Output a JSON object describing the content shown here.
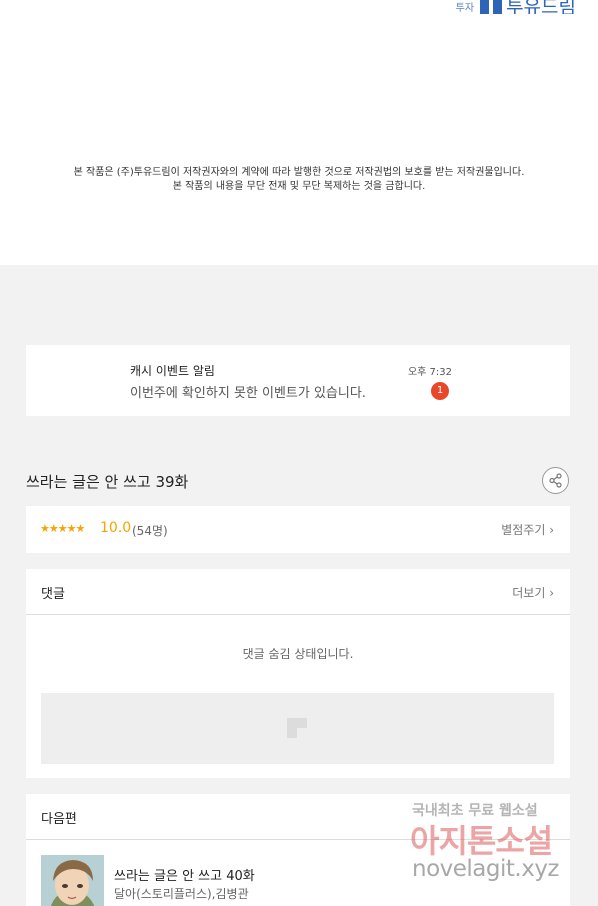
{
  "publisher": {
    "small_label": "투자",
    "brand": "투유드림"
  },
  "copyright": {
    "line1": "본 작품은 (주)투유드림이 저작권자와의 계약에 따라 발행한 것으로 저작권법의 보호를 받는 저작권물입니다.",
    "line2": "본 작품의 내용을 무단 전재 및 무단 복제하는 것을 금합니다."
  },
  "notification": {
    "title": "캐시 이벤트 알림",
    "message": "이번주에 확인하지 못한 이벤트가 있습니다.",
    "time": "오후 7:32",
    "badge": "1"
  },
  "episode": {
    "title": "쓰라는 글은 안 쓰고 39화",
    "share_icon": "share-icon"
  },
  "rating": {
    "stars": "★★★★★",
    "score": "10.0",
    "count": "(54명)",
    "rate_link": "별점주기"
  },
  "comments": {
    "label": "댓글",
    "more": "더보기",
    "hidden_message": "댓글 숨김 상태입니다."
  },
  "next": {
    "label": "다음편",
    "episode_title": "쓰라는 글은 안 쓰고 40화",
    "author": "달아(스토리플러스),김병관"
  },
  "watermark": {
    "line1": "국내최초 무료 웹소설",
    "line2": "아지톤소설",
    "line3": "novelagit.xyz"
  },
  "colors": {
    "accent_orange": "#f5a400",
    "badge_red": "#e8472b",
    "brand_blue": "#2e63b8"
  }
}
